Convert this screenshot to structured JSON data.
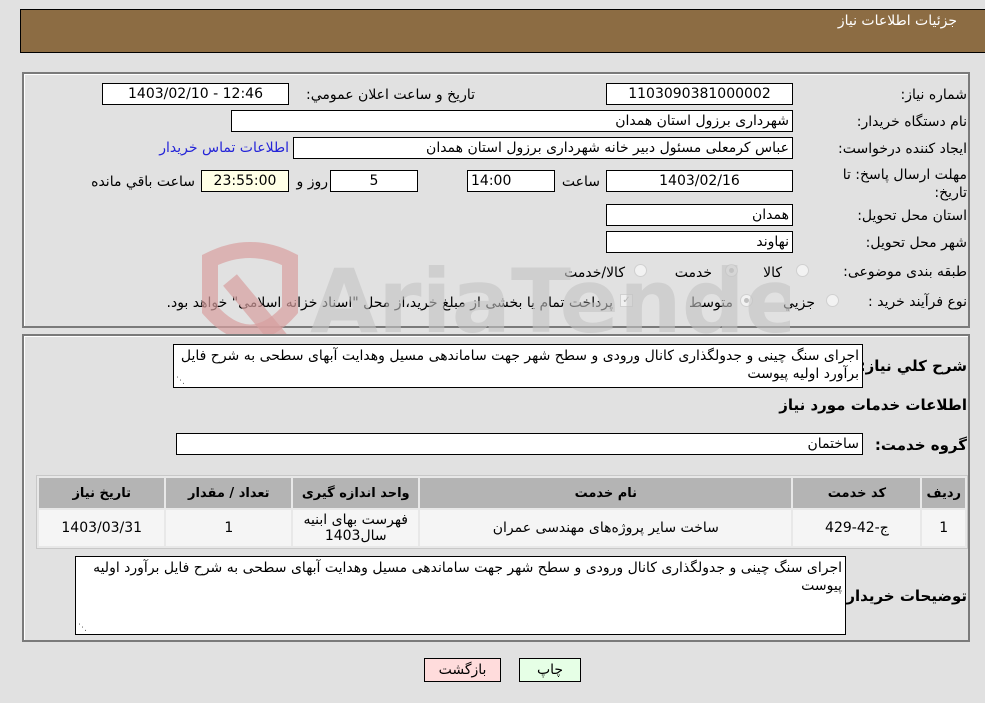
{
  "header": {
    "title": "جزئیات اطلاعات نیاز"
  },
  "form": {
    "need_number": {
      "label": "شماره نیاز:",
      "value": "1103090381000002"
    },
    "announce_datetime": {
      "label": "تاریخ و ساعت اعلان عمومي:",
      "value": "1403/02/10 - 12:46"
    },
    "buyer_org": {
      "label": "نام دستگاه خریدار:",
      "value": "شهرداری برزول استان همدان"
    },
    "requester": {
      "label": "ایجاد کننده درخواست:",
      "value": "عباس  کرمعلی مسئول دبیر خانه شهرداری برزول استان همدان"
    },
    "buyer_contact_link": "اطلاعات تماس خریدار",
    "deadline": {
      "label": "مهلت ارسال پاسخ: تا تاریخ:",
      "date": "1403/02/16",
      "time_label": "ساعت",
      "time": "14:00",
      "days": "5",
      "days_label": "روز و",
      "remaining": "23:55:00",
      "remaining_label": "ساعت باقي مانده"
    },
    "delivery_province": {
      "label": "استان محل تحویل:",
      "value": "همدان"
    },
    "delivery_city": {
      "label": "شهر محل تحویل:",
      "value": "نهاوند"
    },
    "category": {
      "label": "طبقه بندی موضوعی:",
      "options": [
        "کالا",
        "خدمت",
        "کالا/خدمت"
      ],
      "selected": "خدمت"
    },
    "purchase_type": {
      "label": "نوع فرآیند خرید :",
      "options": [
        "جزيي",
        "متوسط"
      ],
      "selected": "متوسط",
      "payment_note": "پرداخت تمام یا بخشی از مبلغ خرید،از محل \"اسناد خزانه اسلامی\" خواهد بود.",
      "payment_checked": true
    }
  },
  "details": {
    "general_desc_label": "شرح کلي نیاز:",
    "general_desc": "اجرای سنگ چینی و جدولگذاری کانال ورودی و سطح شهر جهت ساماندهی مسیل وهدایت آبهای سطحی به شرح فایل برآورد اولیه پیوست",
    "services_title": "اطلاعات خدمات مورد نیاز",
    "service_group_label": "گروه خدمت:",
    "service_group": "ساختمان",
    "table": {
      "headers": [
        "ردیف",
        "کد خدمت",
        "نام خدمت",
        "واحد اندازه گیری",
        "تعداد / مقدار",
        "تاریخ نیاز"
      ],
      "rows": [
        [
          "1",
          "ج-42-429",
          "ساخت سایر پروژه‌های مهندسی عمران",
          "فهرست بهای ابنیه سال1403",
          "1",
          "1403/03/31"
        ]
      ]
    },
    "buyer_notes_label": "توضیحات خریدار:",
    "buyer_notes": "اجرای سنگ چینی و جدولگذاری کانال ورودی و سطح شهر جهت ساماندهی مسیل وهدایت آبهای سطحی به شرح فایل برآورد اولیه پیوست"
  },
  "buttons": {
    "print": "چاپ",
    "back": "بازگشت"
  },
  "watermark": "AriaTender.neT"
}
